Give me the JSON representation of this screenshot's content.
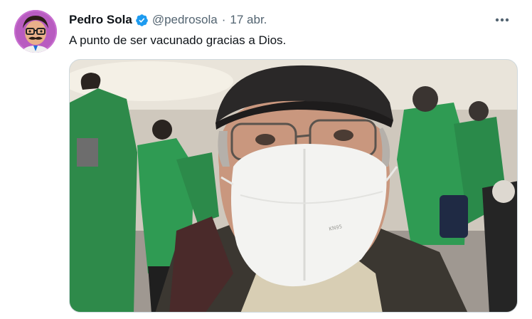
{
  "tweet": {
    "author_name": "Pedro Sola",
    "handle": "@pedrosola",
    "separator": "·",
    "date": "17 abr.",
    "text": "A punto de ser vacunado gracias a Dios.",
    "more_label": "•••"
  },
  "icons": {
    "verified": "verified-badge-icon",
    "more": "more-options-icon"
  },
  "colors": {
    "verified_blue": "#1d9bf0",
    "secondary_text": "#536471"
  }
}
